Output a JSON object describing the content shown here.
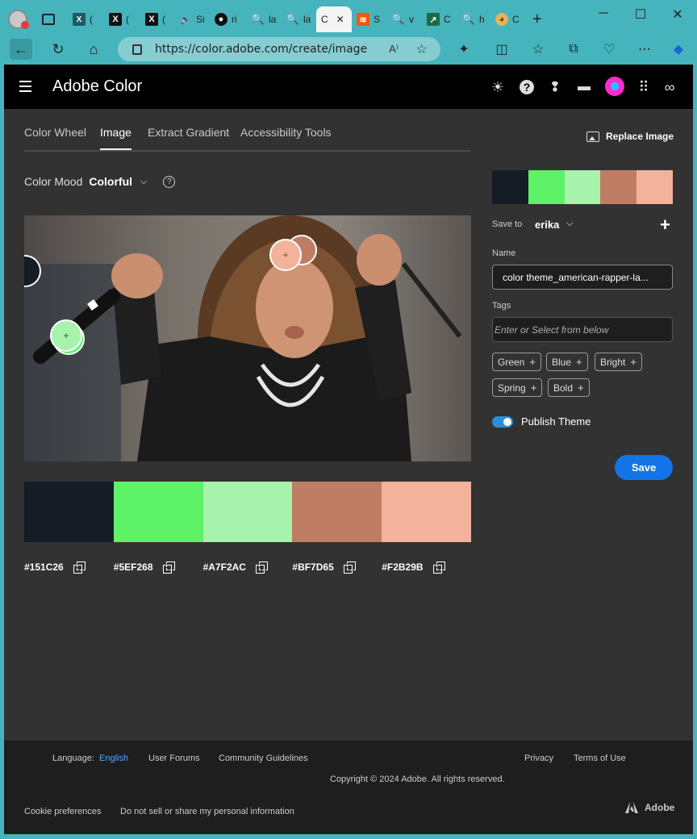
{
  "browser": {
    "tabs": [
      {
        "icon": "x-icon",
        "label": "("
      },
      {
        "icon": "x-icon",
        "label": "("
      },
      {
        "icon": "x-icon",
        "label": "("
      },
      {
        "icon": "speaker-icon",
        "label": "Si"
      },
      {
        "icon": "github-icon",
        "label": "ri"
      },
      {
        "icon": "search-icon",
        "label": "la"
      },
      {
        "icon": "search-icon",
        "label": "la"
      },
      {
        "icon": "adobe-color-icon",
        "label": "C"
      },
      {
        "icon": "soundcloud-icon",
        "label": "S"
      },
      {
        "icon": "search-icon",
        "label": "v"
      },
      {
        "icon": "chart-icon",
        "label": "C"
      },
      {
        "icon": "search-icon",
        "label": "h"
      },
      {
        "icon": "cat-icon",
        "label": "C"
      }
    ],
    "active_tab_close": "✕",
    "url": "https://color.adobe.com/create/image"
  },
  "app": {
    "title": "Adobe Color"
  },
  "nav": {
    "tabs": [
      "Color Wheel",
      "Image",
      "Extract Gradient",
      "Accessibility Tools"
    ],
    "active": "Image",
    "replace_image": "Replace Image"
  },
  "mood": {
    "label": "Color Mood",
    "value": "Colorful",
    "options_visible": [
      "Colorful"
    ]
  },
  "palette": {
    "colors": [
      "#151C26",
      "#5EF268",
      "#A7F2AC",
      "#BF7D65",
      "#F2B29B"
    ]
  },
  "panel": {
    "save_to_label": "Save to",
    "save_to_value": "erika",
    "name_label": "Name",
    "name_value": "color theme_american-rapper-la...",
    "tags_label": "Tags",
    "tags_placeholder": "Enter or Select from below",
    "tags": [
      "Green",
      "Blue",
      "Bright",
      "Spring",
      "Bold"
    ],
    "publish_label": "Publish Theme",
    "publish_on": true,
    "save_button": "Save"
  },
  "footer": {
    "language_label": "Language:",
    "language_value": "English",
    "user_forums": "User Forums",
    "community_guidelines": "Community Guidelines",
    "privacy": "Privacy",
    "terms": "Terms of Use",
    "copyright": "Copyright © 2024 Adobe. All rights reserved.",
    "cookie": "Cookie preferences",
    "do_not_sell": "Do not sell or share my personal information",
    "brand": "Adobe"
  }
}
